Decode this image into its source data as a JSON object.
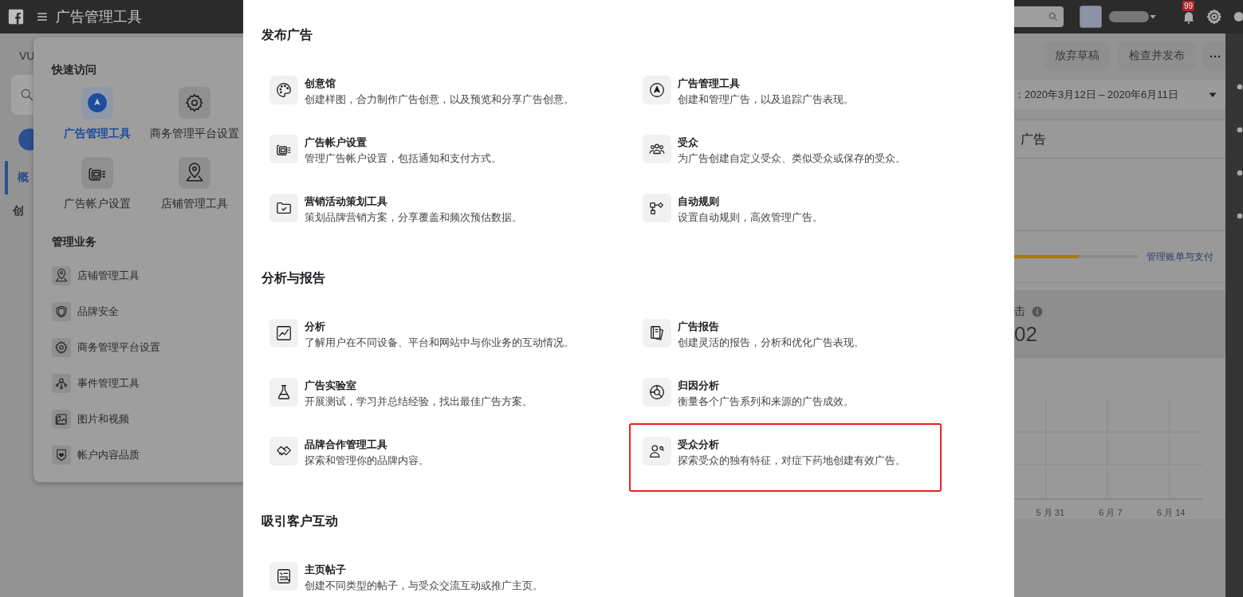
{
  "topbar": {
    "title": "广告管理工具",
    "notification_count": "99"
  },
  "backdrop": {
    "account_label": "VU",
    "tabs": [
      {
        "label": "概",
        "selected": true
      },
      {
        "label": "创",
        "selected": false
      }
    ],
    "actions": [
      "放弃草稿",
      "检查并发布"
    ],
    "more_button": "···",
    "date_range": "：2020年3月12日 – 2020年6月11日",
    "section_title": "广告",
    "billing": {
      "level": 0.52,
      "link": "管理账单与支付"
    },
    "metric": {
      "label": "击",
      "value": "02"
    },
    "chart_labels": [
      "5 月 31",
      "6 月 7",
      "6 月 14"
    ]
  },
  "quick_panel": {
    "quick_title": "快速访问",
    "quick_items": [
      {
        "label": "广告管理工具",
        "selected": true
      },
      {
        "label": "商务管理平台设置",
        "selected": false
      },
      {
        "label": "广告帐户设置",
        "selected": false
      },
      {
        "label": "店铺管理工具",
        "selected": false
      }
    ],
    "manage_title": "管理业务",
    "manage_items": [
      "店铺管理工具",
      "品牌安全",
      "商务管理平台设置",
      "事件管理工具",
      "图片和视频",
      "帐户内容品质"
    ]
  },
  "modal": {
    "sections": [
      {
        "title": "发布广告",
        "items": [
          {
            "title": "创意馆",
            "desc": "创建样图，合力制作广告创意，以及预览和分享广告创意。",
            "highlighted": false
          },
          {
            "title": "广告管理工具",
            "desc": "创建和管理广告，以及追踪广告表现。",
            "highlighted": false
          },
          {
            "title": "广告帐户设置",
            "desc": "管理广告帐户设置，包括通知和支付方式。",
            "highlighted": false
          },
          {
            "title": "受众",
            "desc": "为广告创建自定义受众、类似受众或保存的受众。",
            "highlighted": false
          },
          {
            "title": "营销活动策划工具",
            "desc": "策划品牌营销方案，分享覆盖和频次预估数据。",
            "highlighted": false
          },
          {
            "title": "自动规则",
            "desc": "设置自动规则，高效管理广告。",
            "highlighted": false
          }
        ]
      },
      {
        "title": "分析与报告",
        "items": [
          {
            "title": "分析",
            "desc": "了解用户在不同设备、平台和网站中与你业务的互动情况。",
            "highlighted": false
          },
          {
            "title": "广告报告",
            "desc": "创建灵活的报告，分析和优化广告表现。",
            "highlighted": false
          },
          {
            "title": "广告实验室",
            "desc": "开展测试，学习并总结经验，找出最佳广告方案。",
            "highlighted": false
          },
          {
            "title": "归因分析",
            "desc": "衡量各个广告系列和来源的广告成效。",
            "highlighted": false
          },
          {
            "title": "品牌合作管理工具",
            "desc": "探索和管理你的品牌内容。",
            "highlighted": false
          },
          {
            "title": "受众分析",
            "desc": "探索受众的独有特征，对症下药地创建有效广告。",
            "highlighted": true
          }
        ]
      },
      {
        "title": "吸引客户互动",
        "items": [
          {
            "title": "主页帖子",
            "desc": "创建不同类型的帖子，与受众交流互动或推广主页。",
            "highlighted": false
          }
        ]
      }
    ]
  }
}
